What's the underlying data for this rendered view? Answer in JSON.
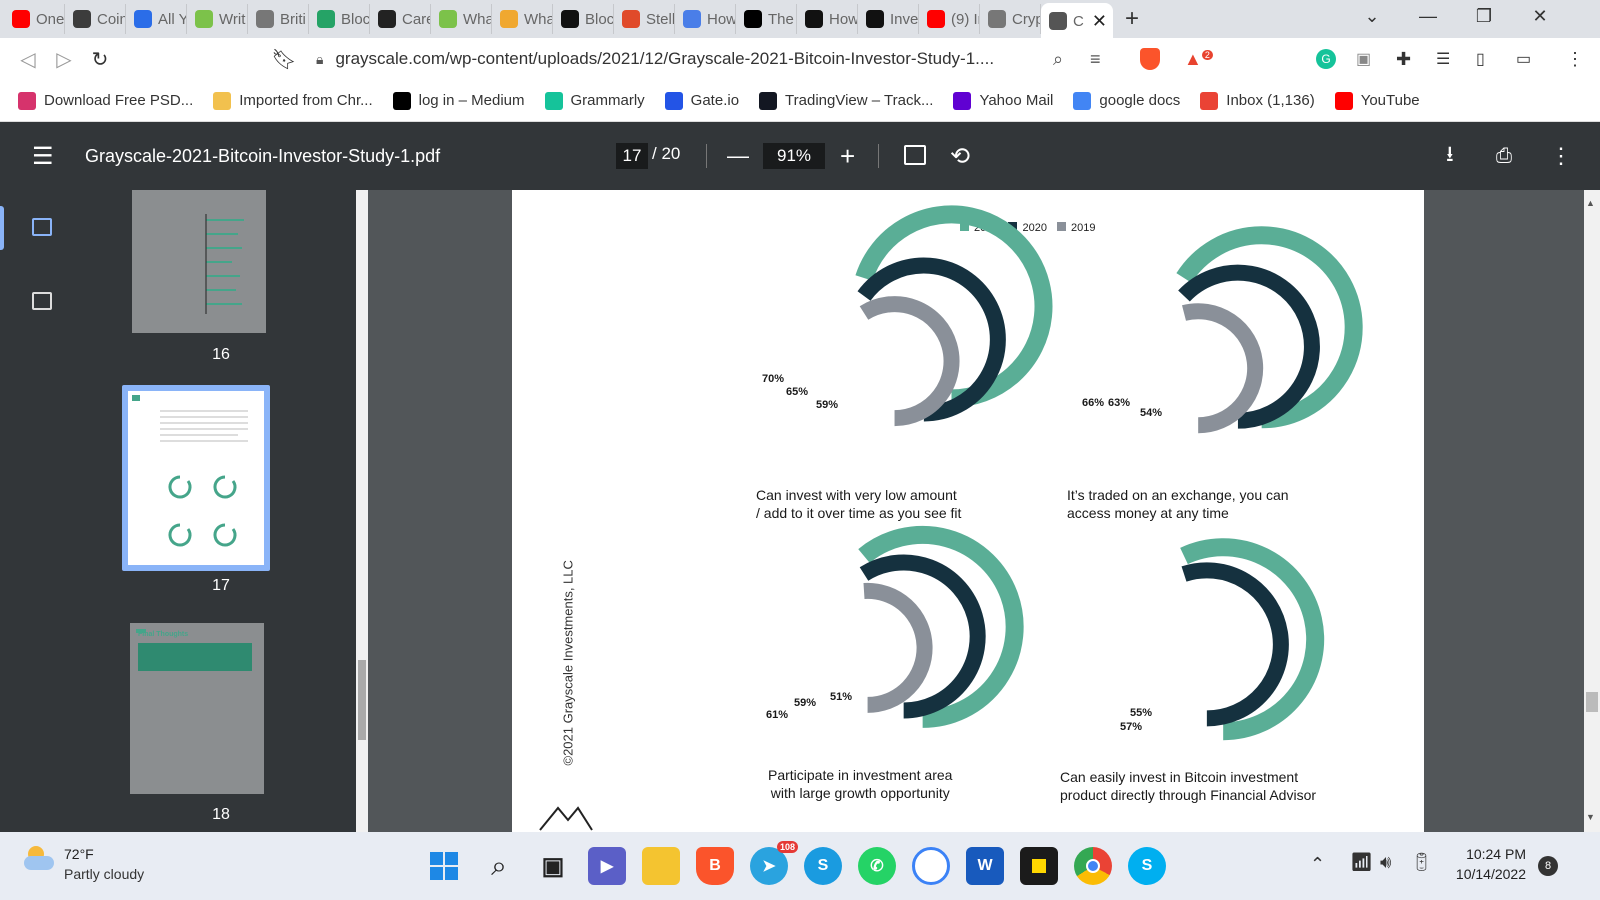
{
  "browser": {
    "tabs": [
      {
        "label": "One",
        "icon": "youtube-icon",
        "color": "#ff0000"
      },
      {
        "label": "Coin",
        "icon": "coin-icon",
        "color": "#3c3c3c"
      },
      {
        "label": "All Y",
        "icon": "globe-icon",
        "color": "#2b6de8"
      },
      {
        "label": "Writ",
        "icon": "write-icon",
        "color": "#7cc24a"
      },
      {
        "label": "Briti",
        "icon": "brit-icon",
        "color": "#777777"
      },
      {
        "label": "Bloc",
        "icon": "sheet-icon",
        "color": "#25a366"
      },
      {
        "label": "Care",
        "icon": "care-icon",
        "color": "#222222"
      },
      {
        "label": "Wha",
        "icon": "write-icon",
        "color": "#7cc24a"
      },
      {
        "label": "Wha",
        "icon": "coin-icon",
        "color": "#f0a830"
      },
      {
        "label": "Bloc",
        "icon": "block-icon",
        "color": "#111111"
      },
      {
        "label": "Stell",
        "icon": "shield-icon",
        "color": "#e04a2a"
      },
      {
        "label": "How",
        "icon": "doc-icon",
        "color": "#4a7ee8"
      },
      {
        "label": "The",
        "icon": "medium-icon",
        "color": "#000000"
      },
      {
        "label": "How",
        "icon": "binance-icon",
        "color": "#111111"
      },
      {
        "label": "Inve",
        "icon": "b-icon",
        "color": "#111111"
      },
      {
        "label": "(9) Ir",
        "icon": "youtube-icon",
        "color": "#ff0000"
      },
      {
        "label": "Cryp",
        "icon": "cryp-icon",
        "color": "#777777"
      },
      {
        "label": "C",
        "icon": "globe-icon",
        "color": "#555555",
        "active": true
      }
    ],
    "url": "grayscale.com/wp-content/uploads/2021/12/Grayscale-2021-Bitcoin-Investor-Study-1....",
    "brave_badge": "2",
    "bookmarks": [
      {
        "label": "Download Free PSD...",
        "icon": "psd-icon",
        "color": "#d6336c"
      },
      {
        "label": "Imported from Chr...",
        "icon": "folder-icon",
        "color": "#f2c14e"
      },
      {
        "label": "log in – Medium",
        "icon": "medium-icon",
        "color": "#000000"
      },
      {
        "label": "Grammarly",
        "icon": "grammarly-icon",
        "color": "#15c39a"
      },
      {
        "label": "Gate.io",
        "icon": "gate-icon",
        "color": "#2354e6"
      },
      {
        "label": "TradingView – Track...",
        "icon": "tradingview-icon",
        "color": "#131722"
      },
      {
        "label": "Yahoo Mail",
        "icon": "mail-icon",
        "color": "#6001d2"
      },
      {
        "label": "google docs",
        "icon": "doc-icon",
        "color": "#4285f4"
      },
      {
        "label": "Inbox (1,136)",
        "icon": "gmail-icon",
        "color": "#ea4335"
      },
      {
        "label": "YouTube",
        "icon": "youtube-icon",
        "color": "#ff0000"
      }
    ]
  },
  "pdf": {
    "filename": "Grayscale-2021-Bitcoin-Investor-Study-1.pdf",
    "current_page": "17",
    "total_pages": "/ 20",
    "zoom": "91%",
    "thumbnails": [
      "16",
      "17",
      "18"
    ],
    "thumb18_title": "Final Thoughts"
  },
  "page": {
    "copyright": "©2021 Grayscale Investments, LLC"
  },
  "chart_data": {
    "type": "radial-bar",
    "legend": [
      "2021",
      "2020",
      "2019"
    ],
    "colors": {
      "2021": "#5aae96",
      "2020": "#15313f",
      "2019": "#8a9099"
    },
    "panels": [
      {
        "caption_1": "Can invest with very low amount",
        "caption_2": "/ add to it over time as you see fit",
        "values": {
          "2021": 70,
          "2020": 65,
          "2019": 59
        },
        "labels": [
          "70%",
          "65%",
          "59%"
        ]
      },
      {
        "caption_1": "It’s traded on an exchange, you can",
        "caption_2": "access money at any time",
        "values": {
          "2021": 66,
          "2020": 63,
          "2019": 54
        },
        "labels": [
          "66%",
          "63%",
          "54%"
        ]
      },
      {
        "caption_1": "Participate in investment area",
        "caption_2": "with large growth opportunity",
        "values": {
          "2021": 61,
          "2020": 59,
          "2019": 51
        },
        "labels": [
          "61%",
          "59%",
          "51%"
        ]
      },
      {
        "caption_1": "Can easily invest in Bitcoin investment",
        "caption_2": "product directly through Financial Advisor",
        "values": {
          "2021": 57,
          "2020": 55
        },
        "labels": [
          "57%",
          "55%"
        ]
      }
    ]
  },
  "taskbar": {
    "weather_temp": "72°F",
    "weather_desc": "Partly cloudy",
    "time": "10:24 PM",
    "date": "10/14/2022",
    "notif_count": "8",
    "telegram_badge": "108"
  }
}
